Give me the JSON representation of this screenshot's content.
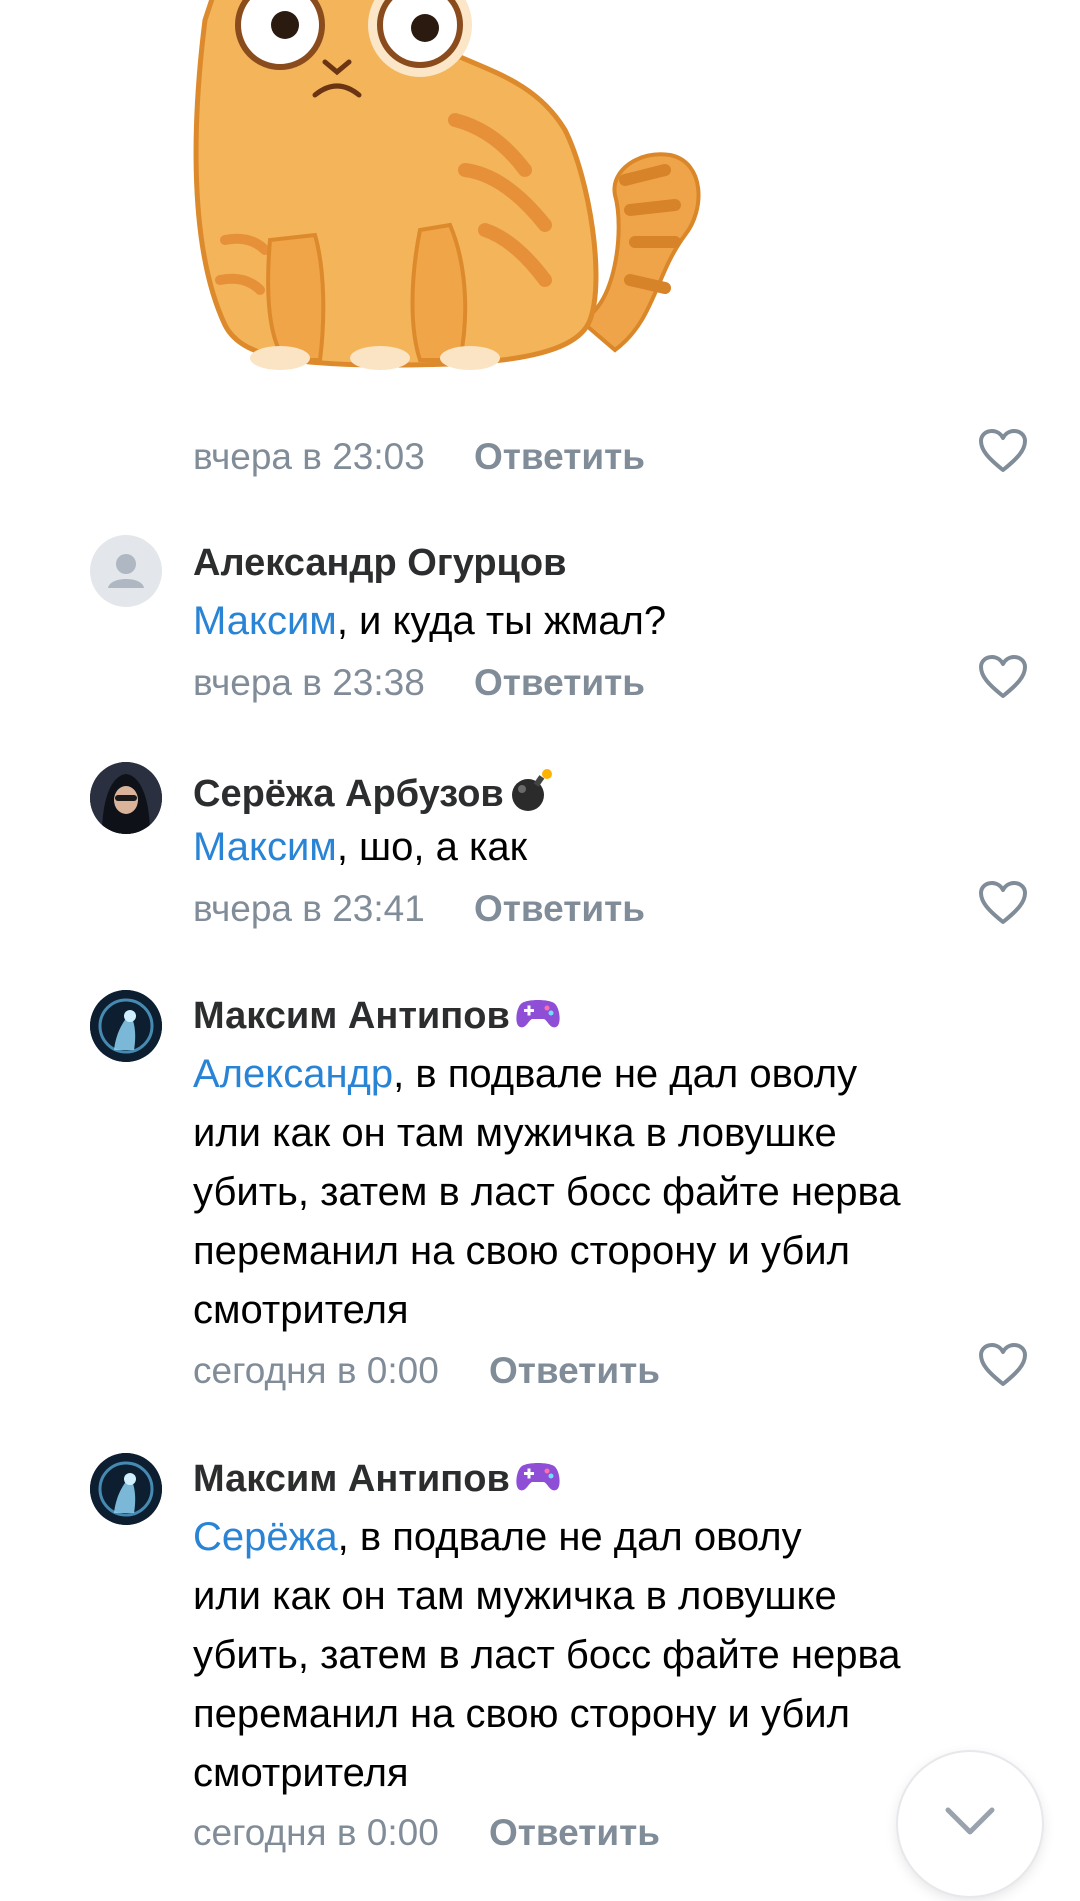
{
  "sticker": {
    "icon": "grumpy-orange-cat-sticker"
  },
  "first_meta": {
    "time": "вчера в 23:03",
    "reply": "Ответить"
  },
  "comments": [
    {
      "author": "Александр Огурцов",
      "badge": "",
      "avatar": "default-avatar",
      "mention": "Максим",
      "text_lines": [
        ", и куда ты жмал?"
      ],
      "time": "вчера в 23:38",
      "reply": "Ответить"
    },
    {
      "author": "Серёжа Арбузов",
      "badge": "bomb-icon",
      "avatar": "photo-avatar",
      "mention": "Максим",
      "text_lines": [
        ", шо, а как"
      ],
      "time": "вчера в 23:41",
      "reply": "Ответить"
    },
    {
      "author": "Максим Антипов",
      "badge": "gamepad-icon",
      "avatar": "photo-avatar",
      "mention": "Александр",
      "text_lines": [
        ", в подвале не дал оволу",
        "или как он там мужичка в ловушке",
        "убить, затем в ласт босс файте нерва",
        "переманил на свою сторону и убил",
        "смотрителя"
      ],
      "time": "сегодня в 0:00",
      "reply": "Ответить"
    },
    {
      "author": "Максим Антипов",
      "badge": "gamepad-icon",
      "avatar": "photo-avatar",
      "mention": "Серёжа",
      "text_lines": [
        ", в подвале не дал оволу",
        "или как он там мужичка в ловушке",
        "убить, затем в ласт босс файте нерва",
        "переманил на свою сторону и убил",
        "смотрителя"
      ],
      "time": "сегодня в 0:00",
      "reply": "Ответить"
    }
  ],
  "colors": {
    "mention": "#2a84d6",
    "meta": "#818c99",
    "author": "#2c2d2e"
  }
}
